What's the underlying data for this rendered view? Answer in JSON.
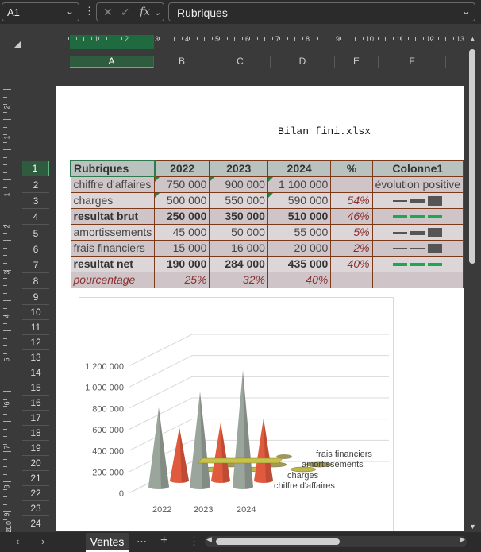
{
  "formula_bar": {
    "cell_ref": "A1",
    "cancel_icon": "✕",
    "enter_icon": "✓",
    "fx_label": "fx",
    "content": "Rubriques"
  },
  "columns": [
    "A",
    "B",
    "C",
    "D",
    "E",
    "F"
  ],
  "ruler_numbers": [
    "1",
    "2",
    "3",
    "4",
    "5",
    "6",
    "7",
    "8",
    "9",
    "10",
    "11",
    "12",
    "13"
  ],
  "vruler_numbers": [
    "2",
    "1",
    "1",
    "2",
    "3",
    "4",
    "5",
    "6",
    "7",
    "8",
    "9",
    "10",
    "11",
    "12"
  ],
  "rows": [
    "1",
    "2",
    "3",
    "4",
    "5",
    "6",
    "7",
    "8",
    "9",
    "10",
    "11",
    "12",
    "13",
    "14",
    "15",
    "16",
    "17",
    "18",
    "19",
    "20",
    "21",
    "22",
    "23",
    "24"
  ],
  "page": {
    "title": "Bilan fini.xlsx"
  },
  "table": {
    "header": [
      "Rubriques",
      "2022",
      "2023",
      "2024",
      "%",
      "Colonne1"
    ],
    "rows": [
      {
        "label": "chiffre d'affaires",
        "v2022": "750 000",
        "v2023": "900 000",
        "v2024": "1 100 000",
        "pct": "",
        "col1": "évolution positive"
      },
      {
        "label": "charges",
        "v2022": "500 000",
        "v2023": "550 000",
        "v2024": "590 000",
        "pct": "54%",
        "col1": ""
      },
      {
        "label": "resultat brut",
        "v2022": "250 000",
        "v2023": "350 000",
        "v2024": "510 000",
        "pct": "46%",
        "col1": ""
      },
      {
        "label": "amortissements",
        "v2022": "45 000",
        "v2023": "50 000",
        "v2024": "55 000",
        "pct": "5%",
        "col1": ""
      },
      {
        "label": "frais financiers",
        "v2022": "15 000",
        "v2023": "16 000",
        "v2024": "20 000",
        "pct": "2%",
        "col1": ""
      },
      {
        "label": "resultat net",
        "v2022": "190 000",
        "v2023": "284 000",
        "v2024": "435 000",
        "pct": "40%",
        "col1": ""
      },
      {
        "label": "pourcentage",
        "v2022": "25%",
        "v2023": "32%",
        "v2024": "40%",
        "pct": "",
        "col1": ""
      }
    ]
  },
  "chart_data": {
    "type": "bar",
    "categories": [
      "2022",
      "2023",
      "2024"
    ],
    "series": [
      {
        "name": "chiffre d'affaires",
        "values": [
          750000,
          900000,
          1100000
        ],
        "color": "#9aa59c"
      },
      {
        "name": "charges",
        "values": [
          500000,
          550000,
          590000
        ],
        "color": "#e05a3e"
      },
      {
        "name": "amortissements",
        "values": [
          45000,
          50000,
          55000
        ],
        "color": "#bdb64a"
      },
      {
        "name": "frais financiers",
        "values": [
          15000,
          16000,
          20000
        ],
        "color": "#a19a5a"
      }
    ],
    "y_ticks": [
      "0",
      "200 000",
      "400 000",
      "600 000",
      "800 000",
      "1 000 000",
      "1 200 000"
    ],
    "ylim": [
      0,
      1200000
    ],
    "title": "",
    "grid": true,
    "shape": "3d-cone"
  },
  "tabs": {
    "sheet_name": "Ventes",
    "more": "⋯",
    "add": "+",
    "menu": "⋮",
    "prev": "‹",
    "next": "›"
  }
}
